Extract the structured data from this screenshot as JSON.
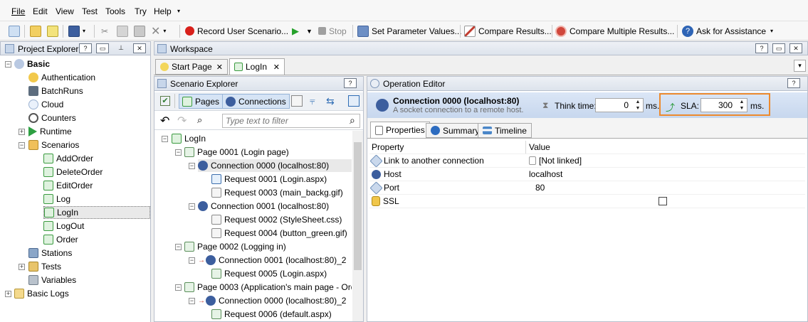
{
  "menu": [
    "File",
    "Edit",
    "View",
    "Test",
    "Tools",
    "Try",
    "Help"
  ],
  "toolbar": {
    "record": "Record User Scenario...",
    "stop": "Stop",
    "set_params": "Set Parameter Values...",
    "compare": "Compare Results...",
    "compare_multi": "Compare Multiple Results...",
    "assist": "Ask for Assistance"
  },
  "project_explorer": {
    "title": "Project Explorer",
    "root": "Basic",
    "items": [
      "Authentication",
      "BatchRuns",
      "Cloud",
      "Counters",
      "Runtime",
      "Scenarios"
    ],
    "scenarios": [
      "AddOrder",
      "DeleteOrder",
      "EditOrder",
      "Log",
      "LogIn",
      "LogOut",
      "Order"
    ],
    "items2": [
      "Stations",
      "Tests",
      "Variables"
    ],
    "logs": "Basic Logs"
  },
  "workspace": {
    "title": "Workspace",
    "tabs": [
      "Start Page",
      "LogIn"
    ]
  },
  "scenario_explorer": {
    "title": "Scenario Explorer",
    "pages_btn": "Pages",
    "connections_btn": "Connections",
    "filter_placeholder": "Type text to filter",
    "tree": {
      "root": "LogIn",
      "nodes": [
        "Page 0001 (Login page)",
        "Connection 0000 (localhost:80)",
        "Request 0001 (Login.aspx)",
        "Request 0003 (main_backg.gif)",
        "Connection 0001 (localhost:80)",
        "Request 0002 (StyleSheet.css)",
        "Request 0004 (button_green.gif)",
        "Page 0002 (Logging in)",
        "Connection 0001 (localhost:80)_2",
        "Request 0005 (Login.aspx)",
        "Page 0003 (Application's main page - Ord...",
        "Connection 0000 (localhost:80)_2",
        "Request 0006 (default.aspx)"
      ]
    }
  },
  "operation_editor": {
    "title": "Operation Editor",
    "conn_title": "Connection 0000 (localhost:80)",
    "conn_desc": "A socket connection to a remote host.",
    "think_label": "Think time:",
    "think_value": "0",
    "think_unit": "ms.",
    "sla_label": "SLA:",
    "sla_value": "300",
    "sla_unit": "ms.",
    "tabs": [
      "Properties",
      "Summary",
      "Timeline"
    ],
    "col_property": "Property",
    "col_value": "Value",
    "rows": [
      {
        "prop": "Link to another connection",
        "value": "[Not linked]"
      },
      {
        "prop": "Host",
        "value": "localhost"
      },
      {
        "prop": "Port",
        "value": "80"
      },
      {
        "prop": "SSL",
        "value": ""
      }
    ]
  }
}
